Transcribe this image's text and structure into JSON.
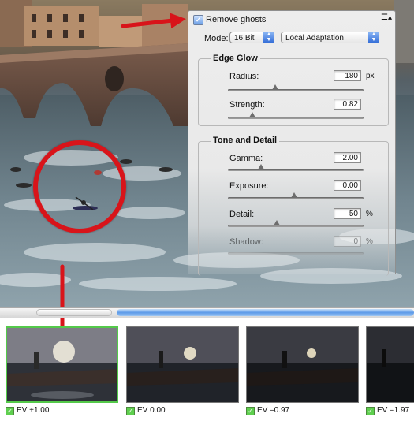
{
  "panel": {
    "remove_ghosts": {
      "label": "Remove ghosts",
      "checked": true
    },
    "mode_label": "Mode:",
    "bit_depth": "16 Bit",
    "method": "Local Adaptation",
    "menu_icon": "list-menu-icon",
    "edge_glow": {
      "title": "Edge Glow",
      "radius": {
        "label": "Radius:",
        "value": "180",
        "unit": "px",
        "level": 0.35
      },
      "strength": {
        "label": "Strength:",
        "value": "0.82",
        "level": 0.12
      }
    },
    "tone_detail": {
      "title": "Tone and Detail",
      "gamma": {
        "label": "Gamma:",
        "value": "2.00",
        "level": 0.36
      },
      "exposure": {
        "label": "Exposure:",
        "value": "0.00",
        "level": 0.5
      },
      "detail": {
        "label": "Detail:",
        "value": "50",
        "unit": "%",
        "level": 0.35
      },
      "shadow": {
        "label": "Shadow:",
        "value": "0",
        "unit": "%",
        "level": 0.5
      }
    }
  },
  "thumbnails": [
    {
      "caption": "EV +1.00",
      "checked": true,
      "selected": true
    },
    {
      "caption": "EV 0.00",
      "checked": true,
      "selected": false
    },
    {
      "caption": "EV –0.97",
      "checked": true,
      "selected": false
    },
    {
      "caption": "EV –1.97",
      "checked": true,
      "selected": false
    }
  ],
  "colors": {
    "annotation_red": "#d8141a",
    "selection_green": "#54c94a",
    "scroll_blue": "#5c9ae8"
  }
}
